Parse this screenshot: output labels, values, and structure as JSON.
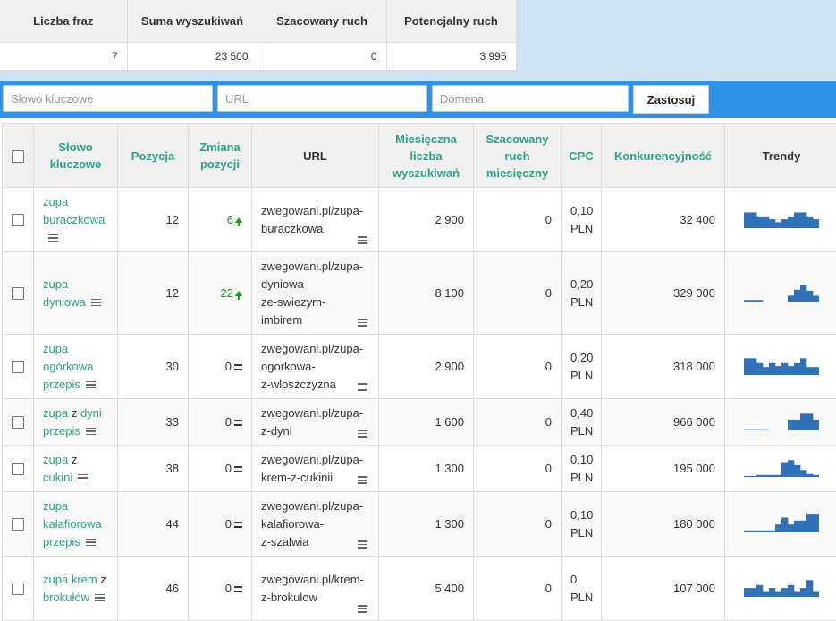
{
  "summary": {
    "headers": [
      "Liczba fraz",
      "Suma wyszukiwań",
      "Szacowany ruch",
      "Potencjalny ruch"
    ],
    "values": [
      "7",
      "23 500",
      "0",
      "3 995"
    ]
  },
  "filters": {
    "keyword_placeholder": "Słowo kluczowe",
    "url_placeholder": "URL",
    "domain_placeholder": "Domena",
    "apply_label": "Zastosuj"
  },
  "table": {
    "headers": {
      "keyword": "Słowo kluczowe",
      "position": "Pozycja",
      "change": "Zmiana pozycji",
      "url": "URL",
      "monthly": "Miesięczna liczba wyszukiwań",
      "traffic": "Szacowany ruch miesięczny",
      "cpc": "CPC",
      "competition": "Konkurencyjność",
      "trends": "Trendy"
    },
    "rows": [
      {
        "kw": [
          "zupa",
          "buraczkowa"
        ],
        "position": "12",
        "change": "6",
        "change_type": "up",
        "url": [
          "zwegowani.pl/zupa-",
          "buraczkowa"
        ],
        "monthly": "2 900",
        "traffic": "0",
        "cpc": [
          "0,10",
          "PLN"
        ],
        "competition": "32 400",
        "trend": [
          0.8,
          0.8,
          0.6,
          0.6,
          0.45,
          0.3,
          0.45,
          0.6,
          0.8,
          0.8,
          0.6,
          0.45
        ],
        "height": 71
      },
      {
        "kw": [
          "zupa",
          "dyniowa"
        ],
        "position": "12",
        "change": "22",
        "change_type": "up",
        "url": [
          "zwegowani.pl/zupa-",
          "dyniowa-",
          "ze-swiezym-",
          "imbirem"
        ],
        "monthly": "8 100",
        "traffic": "0",
        "cpc": [
          "0,20",
          "PLN"
        ],
        "competition": "329 000",
        "trend": [
          0.08,
          0.08,
          0.08,
          0.0,
          0.0,
          0.0,
          0.0,
          0.3,
          0.6,
          0.85,
          0.55,
          0.3
        ],
        "height": 91
      },
      {
        "kw": [
          "zupa",
          "ogórkowa",
          "przepis"
        ],
        "position": "30",
        "change": "0",
        "change_type": "eq",
        "url": [
          "zwegowani.pl/zupa-",
          "ogorkowa-",
          "z-wloszczyzna"
        ],
        "monthly": "2 900",
        "traffic": "0",
        "cpc": [
          "0,20",
          "PLN"
        ],
        "competition": "318 000",
        "trend": [
          0.85,
          0.85,
          0.6,
          0.4,
          0.6,
          0.45,
          0.6,
          0.45,
          0.6,
          0.85,
          0.4,
          0.4
        ],
        "height": 71
      },
      {
        "kw": [
          "zupa",
          "z",
          "dyni",
          "przepis"
        ],
        "position": "33",
        "change": "0",
        "change_type": "eq",
        "url": [
          "zwegowani.pl/zupa-",
          "z-dyni"
        ],
        "monthly": "1 600",
        "traffic": "0",
        "cpc": [
          "0,40",
          "PLN"
        ],
        "competition": "966 000",
        "trend": [
          0.06,
          0.06,
          0.06,
          0.06,
          0.0,
          0.0,
          0.0,
          0.55,
          0.55,
          0.85,
          0.85,
          0.55
        ],
        "height": 51
      },
      {
        "kw": [
          "zupa",
          "z",
          "cukini"
        ],
        "position": "38",
        "change": "0",
        "change_type": "eq",
        "url": [
          "zwegowani.pl/zupa-",
          "krem-z-cukinii"
        ],
        "monthly": "1 300",
        "traffic": "0",
        "cpc": [
          "0,10",
          "PLN"
        ],
        "competition": "195 000",
        "trend": [
          0.05,
          0.05,
          0.1,
          0.1,
          0.1,
          0.1,
          0.75,
          0.85,
          0.6,
          0.35,
          0.15,
          0.1
        ],
        "height": 51
      },
      {
        "kw": [
          "zupa",
          "kalafiorowa",
          "przepis"
        ],
        "position": "44",
        "change": "0",
        "change_type": "eq",
        "url": [
          "zwegowani.pl/zupa-",
          "kalafiorowa-",
          "z-szalwia"
        ],
        "monthly": "1 300",
        "traffic": "0",
        "cpc": [
          "0,10",
          "PLN"
        ],
        "competition": "180 000",
        "trend": [
          0.1,
          0.1,
          0.1,
          0.1,
          0.1,
          0.4,
          0.75,
          0.4,
          0.6,
          0.6,
          0.95,
          0.95
        ],
        "height": 71
      },
      {
        "kw": [
          "zupa",
          "krem",
          "z",
          "brokułów"
        ],
        "position": "46",
        "change": "0",
        "change_type": "eq",
        "url": [
          "zwegowani.pl/krem-",
          "z-brokulow"
        ],
        "monthly": "5 400",
        "traffic": "0",
        "cpc": [
          "0",
          "PLN"
        ],
        "competition": "107 000",
        "trend": [
          0.45,
          0.45,
          0.6,
          0.25,
          0.45,
          0.25,
          0.45,
          0.6,
          0.25,
          0.45,
          0.85,
          0.25
        ],
        "height": 71
      }
    ]
  },
  "colors": {
    "accent": "#2aa188",
    "bar": "#3172b7",
    "filterbar": "#2f92e8",
    "up": "#1aa01a"
  }
}
